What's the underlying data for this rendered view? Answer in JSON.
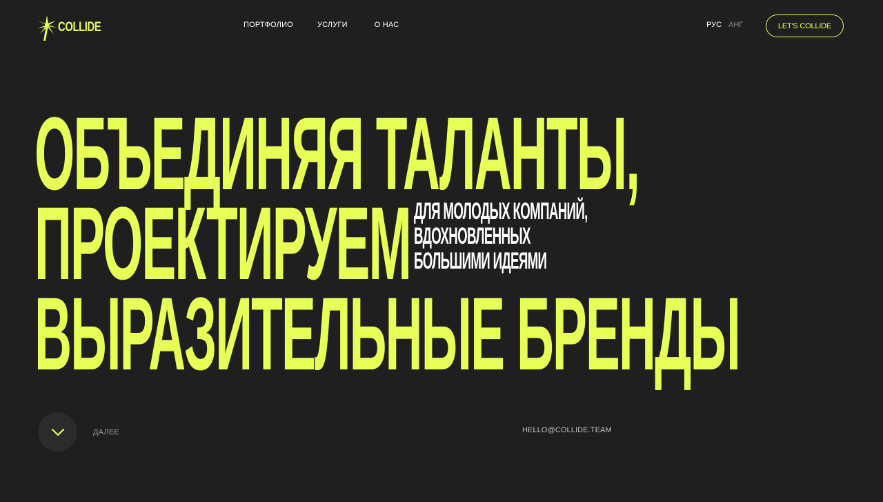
{
  "brand": {
    "name": "COLLIDE",
    "accent_color": "#e8ff57",
    "background_color": "#1f1f1f",
    "logo_icon": "palm-star-icon"
  },
  "nav": {
    "items": [
      {
        "label": "ПОРТФОЛИО"
      },
      {
        "label": "УСЛУГИ"
      },
      {
        "label": "О НАС"
      }
    ]
  },
  "language": {
    "active": "РУС",
    "inactive": "АНГ"
  },
  "cta": {
    "label": "LET'S COLLIDE"
  },
  "hero": {
    "lines": [
      "ОБЪЕДИНЯЯ ТАЛАНТЫ,",
      "ПРОЕКТИРУЕМ",
      "ВЫРАЗИТЕЛЬНЫЕ БРЕНДЫ"
    ],
    "tagline": [
      "ДЛЯ МОЛОДЫХ КОМПАНИЙ,",
      "ВДОХНОВЛЕННЫХ",
      "БОЛЬШИМИ ИДЕЯМИ"
    ]
  },
  "footer": {
    "next_label": "ДАЛЕЕ",
    "scroll_icon": "chevron-down-icon",
    "email": "HELLO@COLLIDE.TEAM"
  }
}
